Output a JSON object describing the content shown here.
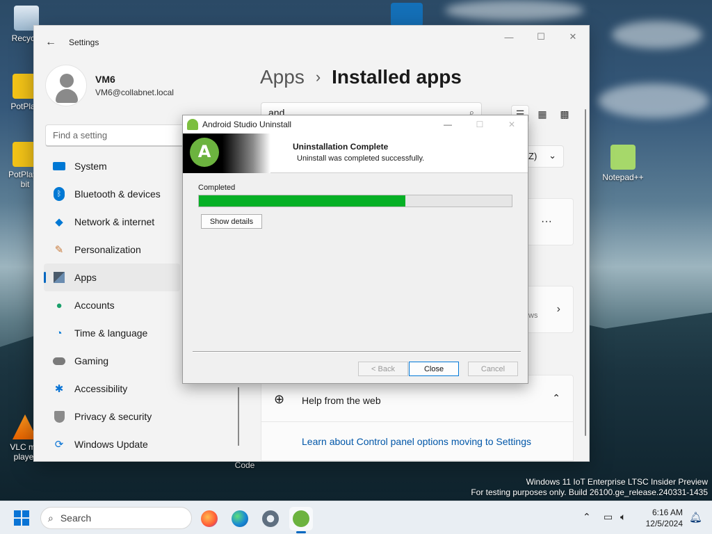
{
  "desktop": {
    "icons": [
      {
        "label": "Recycle",
        "icon": "recycle-bin-icon"
      },
      {
        "label": "PotPlay",
        "icon": "potplayer-icon"
      },
      {
        "label": "PotPlaye bit",
        "icon": "potplayer-64-icon"
      },
      {
        "label": "VLC me player",
        "icon": "vlc-icon"
      },
      {
        "label": "Notepad++",
        "icon": "notepadpp-icon"
      },
      {
        "label": "Code",
        "icon": "vscode-icon"
      }
    ],
    "watermark_line1": "Windows 11 IoT Enterprise LTSC Insider Preview",
    "watermark_line2": "For testing purposes only. Build 26100.ge_release.240331-1435"
  },
  "settings": {
    "window_title": "Settings",
    "user": {
      "name": "VM6",
      "email": "VM6@collabnet.local"
    },
    "find_placeholder": "Find a setting",
    "nav": [
      {
        "label": "System",
        "icon": "monitor-icon",
        "color": "#0078d4"
      },
      {
        "label": "Bluetooth & devices",
        "icon": "bluetooth-icon",
        "color": "#0078d4"
      },
      {
        "label": "Network & internet",
        "icon": "wifi-icon",
        "color": "#0078d4"
      },
      {
        "label": "Personalization",
        "icon": "paintbrush-icon",
        "color": "#c87a3a"
      },
      {
        "label": "Apps",
        "icon": "apps-icon",
        "color": "#4a5a6a"
      },
      {
        "label": "Accounts",
        "icon": "person-icon",
        "color": "#1aa06b"
      },
      {
        "label": "Time & language",
        "icon": "clock-globe-icon",
        "color": "#0078d4"
      },
      {
        "label": "Gaming",
        "icon": "gamepad-icon",
        "color": "#6a6a6a"
      },
      {
        "label": "Accessibility",
        "icon": "accessibility-icon",
        "color": "#0a74d5"
      },
      {
        "label": "Privacy & security",
        "icon": "shield-icon",
        "color": "#6a6a6a"
      },
      {
        "label": "Windows Update",
        "icon": "update-icon",
        "color": "#0a74d5"
      }
    ],
    "active_nav": "Apps",
    "breadcrumb_parent": "Apps",
    "breadcrumb_sep": "›",
    "breadcrumb_current": "Installed apps",
    "search_value": "and",
    "sort_label": "Z)",
    "partial_text": "ws",
    "help_label": "Help from the web",
    "help_link": "Learn about Control panel options moving to Settings"
  },
  "dialog": {
    "title": "Android Studio Uninstall",
    "heading": "Uninstallation Complete",
    "subheading": "Uninstall was completed successfully.",
    "status": "Completed",
    "progress_percent": 66,
    "show_details": "Show details",
    "back": "< Back",
    "close": "Close",
    "cancel": "Cancel"
  },
  "taskbar": {
    "search_label": "Search",
    "time": "6:16 AM",
    "date": "12/5/2024"
  }
}
